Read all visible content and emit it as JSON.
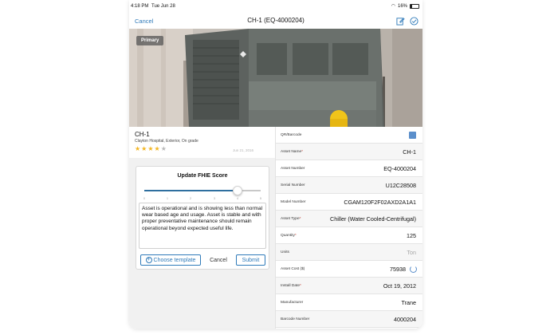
{
  "status_bar": {
    "time": "4:18 PM",
    "date": "Tue Jun 28",
    "battery": "16%",
    "battery_level": 0.16
  },
  "nav": {
    "cancel_label": "Cancel",
    "title": "CH-1 (EQ-4000204)",
    "icons": [
      "edit-icon",
      "checkmark-circle-icon"
    ]
  },
  "photo": {
    "badge": "Primary"
  },
  "asset": {
    "name": "CH-1",
    "location": "Clayton Hospital, Exterior, On grade",
    "rating": 4,
    "rating_max": 5,
    "date": "Jun 21, 2016"
  },
  "fhie": {
    "title": "Update FHIE Score",
    "score": 4,
    "ticks": [
      "0",
      "1",
      "2",
      "3",
      "4",
      "5"
    ],
    "notes": "Asset is operational and is showing less than normal wear based age and usage. Asset is stable and with proper preventative maintenance should remain operational beyond expected useful life.",
    "choose_label": "Choose template",
    "cancel_label": "Cancel",
    "submit_label": "Submit"
  },
  "fields": [
    {
      "label": "QR/Barcode",
      "value": "",
      "required": false,
      "icon": "qr-code-icon"
    },
    {
      "label": "Asset Name",
      "value": "CH-1",
      "required": true
    },
    {
      "label": "Asset Number",
      "value": "EQ-4000204",
      "required": false
    },
    {
      "label": "Serial Number",
      "value": "U12C28508",
      "required": false
    },
    {
      "label": "Model Number",
      "value": "CGAM120F2F02AXD2A1A1",
      "required": false
    },
    {
      "label": "Asset Type",
      "value": "Chiller (Water Cooled-Centrifugal)",
      "required": true
    },
    {
      "label": "Quantity",
      "value": "125",
      "required": true
    },
    {
      "label": "Units",
      "value": "Ton",
      "required": false,
      "muted": true
    },
    {
      "label": "Asset Cost ($)",
      "value": "75938",
      "required": false,
      "icon": "refresh-icon"
    },
    {
      "label": "Install Date",
      "value": "Oct 19, 2012",
      "required": true
    },
    {
      "label": "Manufacturer",
      "value": "Trane",
      "required": false
    },
    {
      "label": "Barcode Number",
      "value": "4000204",
      "required": false
    }
  ]
}
